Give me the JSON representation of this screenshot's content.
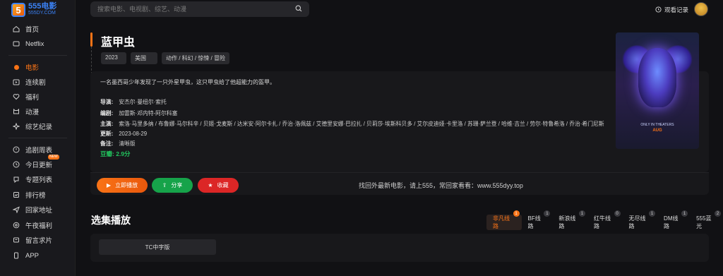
{
  "logo": {
    "badge": "5",
    "title": "555电影",
    "subtitle": "555DY.COM"
  },
  "sidebar": {
    "items": [
      {
        "label": "首页",
        "icon": "home-icon"
      },
      {
        "label": "Netflix",
        "icon": "tv-icon"
      },
      {
        "label": "电影",
        "icon": "dot-icon",
        "active": true
      },
      {
        "label": "连续剧",
        "icon": "series-icon"
      },
      {
        "label": "福利",
        "icon": "heart-icon"
      },
      {
        "label": "动漫",
        "icon": "anime-icon"
      },
      {
        "label": "综艺纪录",
        "icon": "variety-icon"
      },
      {
        "label": "追剧周表",
        "icon": "calendar-icon"
      },
      {
        "label": "今日更新",
        "icon": "clock-icon",
        "badge": "NEW"
      },
      {
        "label": "专题列表",
        "icon": "topic-icon"
      },
      {
        "label": "排行榜",
        "icon": "rank-icon"
      },
      {
        "label": "回家地址",
        "icon": "send-icon"
      },
      {
        "label": "午夜福利",
        "icon": "moon-icon"
      },
      {
        "label": "留言求片",
        "icon": "message-icon"
      },
      {
        "label": "APP",
        "icon": "app-icon"
      }
    ]
  },
  "search": {
    "placeholder": "搜索电影、电视剧、综艺、动漫"
  },
  "header": {
    "history_label": "观看记录"
  },
  "movie": {
    "title": "蓝甲虫",
    "year": "2023",
    "region": "美国",
    "genres": "动作 / 科幻 / 惊悚 / 冒险",
    "description": "一名墨西哥少年发现了一只外星甲虫，这只甲虫给了他超能力的盔甲。",
    "director_label": "导演:",
    "director": "安杰尔·曼纽尔·索托",
    "writer_label": "编剧:",
    "writer": "加雷斯·邓内特-阿尔科塞",
    "cast_label": "主演:",
    "cast": "索洛·马里多纳 / 布鲁娜·马尔科辛 / 贝姬·戈麦斯 / 达米安·阿尔卡扎 / 乔治·洛佩兹 / 艾德里安娜·巴拉扎 / 贝莉莎·埃斯科贝多 / 艾尔皮迪娅·卡里洛 / 苏珊·萨兰登 / 哈维·吉兰 / 劳尔·特鲁希洛 / 乔治·希门尼斯",
    "updated_label": "更新:",
    "updated": "2023-08-29",
    "note_label": "备注:",
    "note": "清晰版",
    "douban_label": "豆瓣:",
    "douban": "2.9分",
    "poster_text": [
      "ONLY IN THEATERS",
      "AUG"
    ]
  },
  "actions": {
    "play_label": "立即播放",
    "share_label": "分享",
    "fav_label": "收藏",
    "notice": "找回外最新电影，请上555，常回家看看：www.555dyy.top"
  },
  "episodes": {
    "title": "选集播放",
    "lines": [
      {
        "label": "非凡线路",
        "count": "1",
        "active": true
      },
      {
        "label": "BF线路",
        "count": "1"
      },
      {
        "label": "新浪线路",
        "count": "1"
      },
      {
        "label": "红牛线路",
        "count": "0"
      },
      {
        "label": "无尽线路",
        "count": "1"
      },
      {
        "label": "DM线路",
        "count": "1"
      },
      {
        "label": "555蓝光",
        "count": "2"
      }
    ],
    "items": [
      "TC中字版"
    ]
  },
  "colors": {
    "accent": "#f97316",
    "share": "#16a34a",
    "fav": "#dc2626",
    "douban": "#22c55e"
  }
}
